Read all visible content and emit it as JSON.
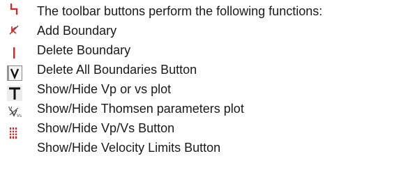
{
  "intro_text": "The toolbar buttons perform the following functions:",
  "items": [
    {
      "icon": "red-boundary-icon",
      "label": "Add Boundary"
    },
    {
      "icon": "red-vertical-bar-icon",
      "label": "Delete Boundary"
    },
    {
      "icon": "v-letter-icon",
      "label": "Delete All Boundaries Button"
    },
    {
      "icon": "t-letter-icon",
      "label": "Show/Hide Vp or vs plot"
    },
    {
      "icon": "vp-vs-icon",
      "label": "Show/Hide Thomsen parameters plot"
    },
    {
      "icon": "velocity-limits-icon",
      "label": "Show/Hide Vp/Vs Button"
    },
    {
      "label": "Show/Hide Velocity Limits Button"
    }
  ],
  "colors": {
    "accent_red": "#e02020",
    "text": "#1a1a1a",
    "icon_frame": "#8a8a8a"
  }
}
